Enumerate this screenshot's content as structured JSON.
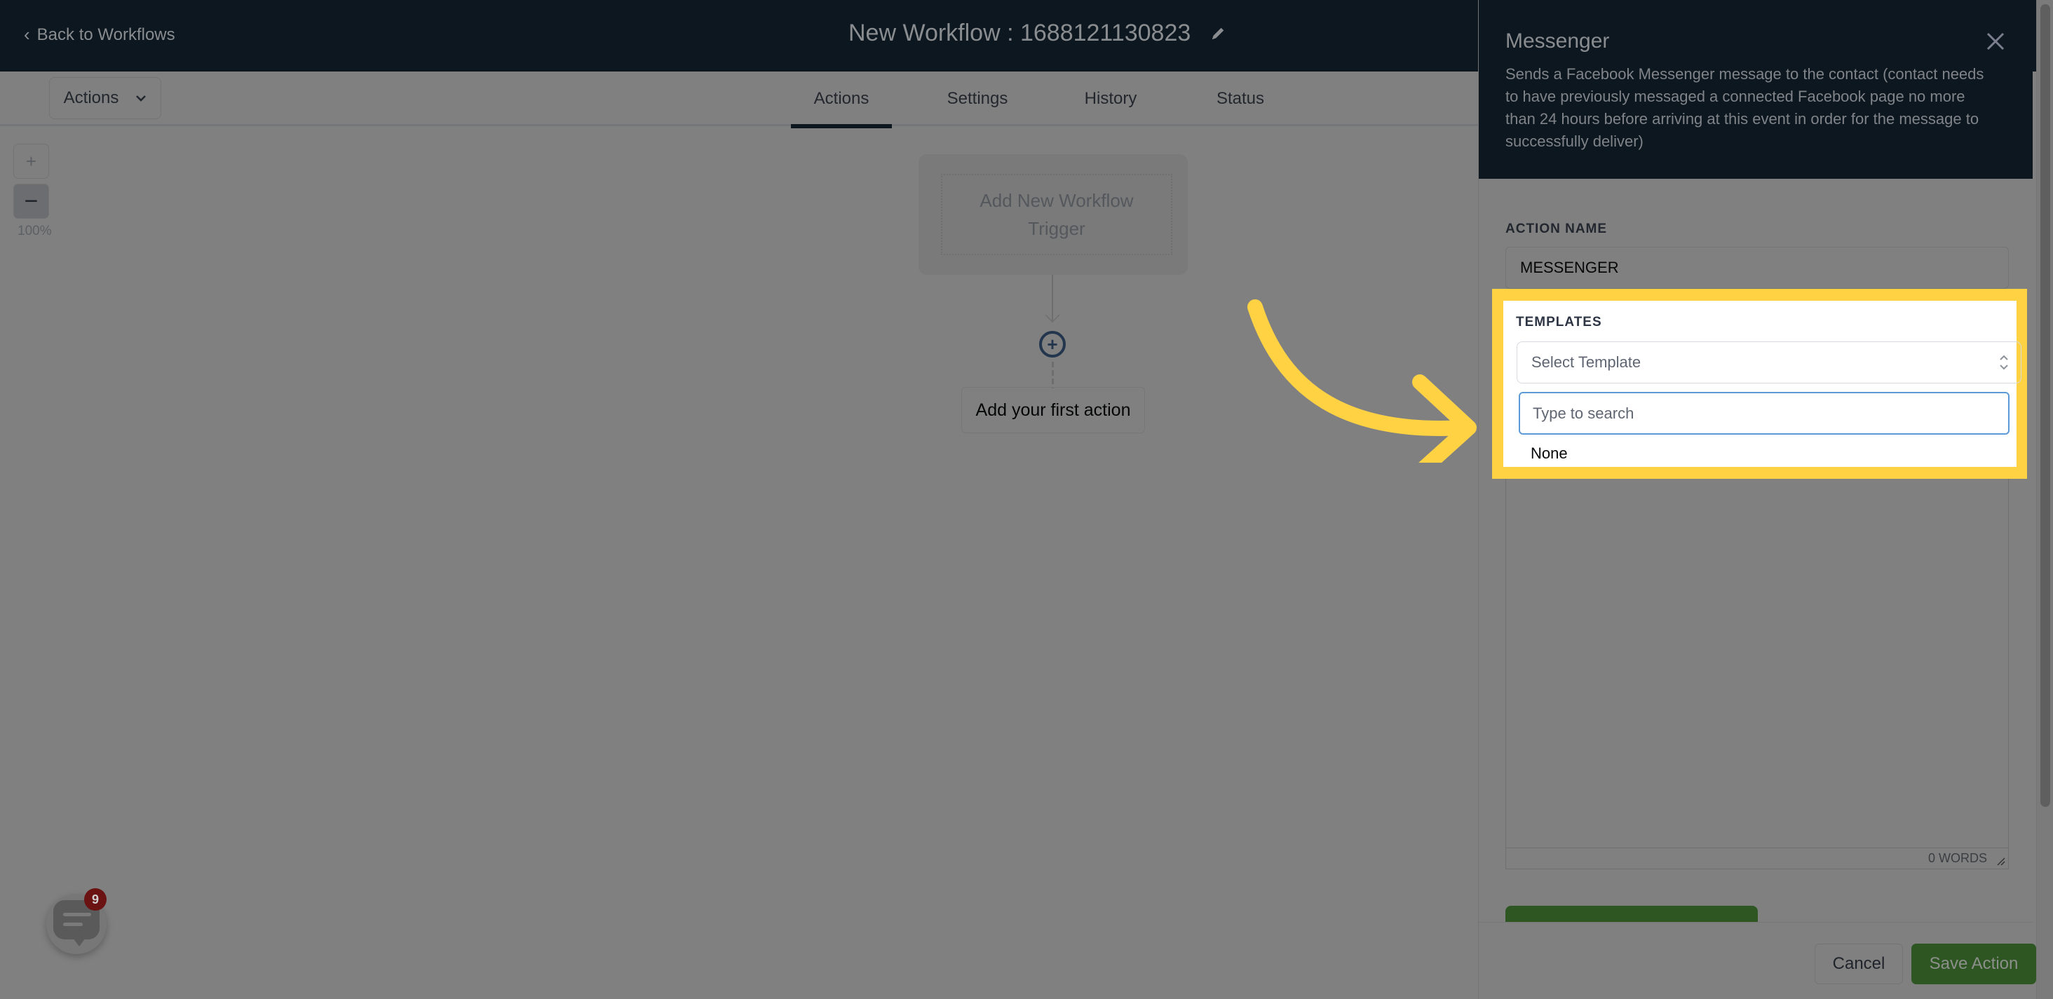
{
  "header": {
    "back_label": "Back to Workflows",
    "workflow_title": "New Workflow : 1688121130823"
  },
  "subnav": {
    "actions_dropdown": "Actions",
    "tabs": [
      {
        "label": "Actions",
        "active": true
      },
      {
        "label": "Settings",
        "active": false
      },
      {
        "label": "History",
        "active": false
      },
      {
        "label": "Status",
        "active": false
      }
    ]
  },
  "canvas": {
    "zoom_in": "+",
    "zoom_out": "−",
    "zoom_level": "100%",
    "trigger_label": "Add New Workflow Trigger",
    "add_icon": "+",
    "first_action_label": "Add your first action"
  },
  "chat_widget": {
    "badge_count": "9"
  },
  "panel": {
    "title": "Messenger",
    "description": "Sends a Facebook Messenger message to the contact (contact needs to have previously messaged a connected Facebook page no more than 24 hours before arriving at this event in order for the message to successfully deliver)",
    "action_name_label": "ACTION NAME",
    "action_name_value": "MESSENGER",
    "templates_label": "TEMPLATES",
    "template_select_placeholder": "Select Template",
    "template_search_placeholder": "Type to search",
    "template_options": [
      "None"
    ],
    "word_count": "0 WORDS",
    "cancel_label": "Cancel",
    "save_label": "Save Action"
  },
  "colors": {
    "header_bg": "#0d1720",
    "highlight": "#ffd243",
    "save_green": "#2d5623",
    "badge_red": "#6b1212",
    "search_focus_border": "#5b9ad6"
  }
}
